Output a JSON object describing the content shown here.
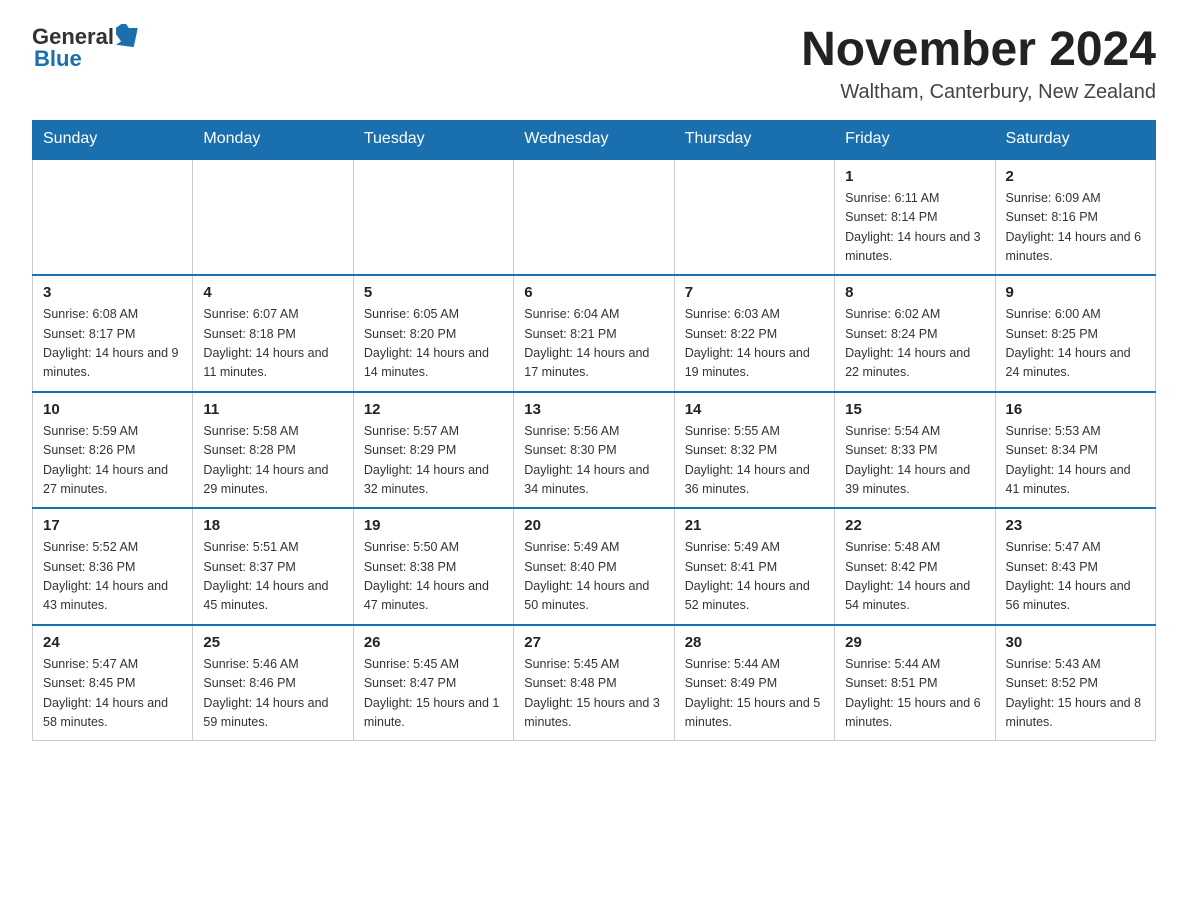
{
  "logo": {
    "text_general": "General",
    "arrow_color": "#1a6faf",
    "text_blue": "Blue"
  },
  "title": "November 2024",
  "subtitle": "Waltham, Canterbury, New Zealand",
  "days_of_week": [
    "Sunday",
    "Monday",
    "Tuesday",
    "Wednesday",
    "Thursday",
    "Friday",
    "Saturday"
  ],
  "weeks": [
    [
      {
        "day": "",
        "info": ""
      },
      {
        "day": "",
        "info": ""
      },
      {
        "day": "",
        "info": ""
      },
      {
        "day": "",
        "info": ""
      },
      {
        "day": "",
        "info": ""
      },
      {
        "day": "1",
        "info": "Sunrise: 6:11 AM\nSunset: 8:14 PM\nDaylight: 14 hours and 3 minutes."
      },
      {
        "day": "2",
        "info": "Sunrise: 6:09 AM\nSunset: 8:16 PM\nDaylight: 14 hours and 6 minutes."
      }
    ],
    [
      {
        "day": "3",
        "info": "Sunrise: 6:08 AM\nSunset: 8:17 PM\nDaylight: 14 hours and 9 minutes."
      },
      {
        "day": "4",
        "info": "Sunrise: 6:07 AM\nSunset: 8:18 PM\nDaylight: 14 hours and 11 minutes."
      },
      {
        "day": "5",
        "info": "Sunrise: 6:05 AM\nSunset: 8:20 PM\nDaylight: 14 hours and 14 minutes."
      },
      {
        "day": "6",
        "info": "Sunrise: 6:04 AM\nSunset: 8:21 PM\nDaylight: 14 hours and 17 minutes."
      },
      {
        "day": "7",
        "info": "Sunrise: 6:03 AM\nSunset: 8:22 PM\nDaylight: 14 hours and 19 minutes."
      },
      {
        "day": "8",
        "info": "Sunrise: 6:02 AM\nSunset: 8:24 PM\nDaylight: 14 hours and 22 minutes."
      },
      {
        "day": "9",
        "info": "Sunrise: 6:00 AM\nSunset: 8:25 PM\nDaylight: 14 hours and 24 minutes."
      }
    ],
    [
      {
        "day": "10",
        "info": "Sunrise: 5:59 AM\nSunset: 8:26 PM\nDaylight: 14 hours and 27 minutes."
      },
      {
        "day": "11",
        "info": "Sunrise: 5:58 AM\nSunset: 8:28 PM\nDaylight: 14 hours and 29 minutes."
      },
      {
        "day": "12",
        "info": "Sunrise: 5:57 AM\nSunset: 8:29 PM\nDaylight: 14 hours and 32 minutes."
      },
      {
        "day": "13",
        "info": "Sunrise: 5:56 AM\nSunset: 8:30 PM\nDaylight: 14 hours and 34 minutes."
      },
      {
        "day": "14",
        "info": "Sunrise: 5:55 AM\nSunset: 8:32 PM\nDaylight: 14 hours and 36 minutes."
      },
      {
        "day": "15",
        "info": "Sunrise: 5:54 AM\nSunset: 8:33 PM\nDaylight: 14 hours and 39 minutes."
      },
      {
        "day": "16",
        "info": "Sunrise: 5:53 AM\nSunset: 8:34 PM\nDaylight: 14 hours and 41 minutes."
      }
    ],
    [
      {
        "day": "17",
        "info": "Sunrise: 5:52 AM\nSunset: 8:36 PM\nDaylight: 14 hours and 43 minutes."
      },
      {
        "day": "18",
        "info": "Sunrise: 5:51 AM\nSunset: 8:37 PM\nDaylight: 14 hours and 45 minutes."
      },
      {
        "day": "19",
        "info": "Sunrise: 5:50 AM\nSunset: 8:38 PM\nDaylight: 14 hours and 47 minutes."
      },
      {
        "day": "20",
        "info": "Sunrise: 5:49 AM\nSunset: 8:40 PM\nDaylight: 14 hours and 50 minutes."
      },
      {
        "day": "21",
        "info": "Sunrise: 5:49 AM\nSunset: 8:41 PM\nDaylight: 14 hours and 52 minutes."
      },
      {
        "day": "22",
        "info": "Sunrise: 5:48 AM\nSunset: 8:42 PM\nDaylight: 14 hours and 54 minutes."
      },
      {
        "day": "23",
        "info": "Sunrise: 5:47 AM\nSunset: 8:43 PM\nDaylight: 14 hours and 56 minutes."
      }
    ],
    [
      {
        "day": "24",
        "info": "Sunrise: 5:47 AM\nSunset: 8:45 PM\nDaylight: 14 hours and 58 minutes."
      },
      {
        "day": "25",
        "info": "Sunrise: 5:46 AM\nSunset: 8:46 PM\nDaylight: 14 hours and 59 minutes."
      },
      {
        "day": "26",
        "info": "Sunrise: 5:45 AM\nSunset: 8:47 PM\nDaylight: 15 hours and 1 minute."
      },
      {
        "day": "27",
        "info": "Sunrise: 5:45 AM\nSunset: 8:48 PM\nDaylight: 15 hours and 3 minutes."
      },
      {
        "day": "28",
        "info": "Sunrise: 5:44 AM\nSunset: 8:49 PM\nDaylight: 15 hours and 5 minutes."
      },
      {
        "day": "29",
        "info": "Sunrise: 5:44 AM\nSunset: 8:51 PM\nDaylight: 15 hours and 6 minutes."
      },
      {
        "day": "30",
        "info": "Sunrise: 5:43 AM\nSunset: 8:52 PM\nDaylight: 15 hours and 8 minutes."
      }
    ]
  ]
}
